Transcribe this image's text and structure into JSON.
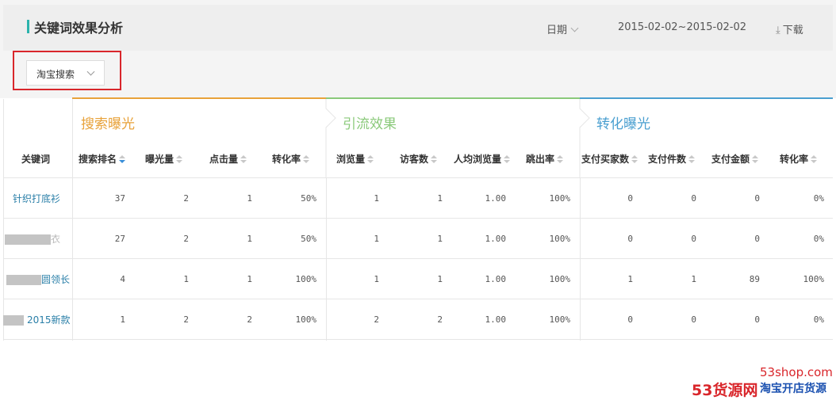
{
  "header": {
    "title": "关键词效果分析",
    "date_label": "日期",
    "date_range": "2015-02-02~2015-02-02",
    "download_label": "下载"
  },
  "filter": {
    "selected": "淘宝搜索"
  },
  "groups": [
    {
      "label": "搜索曝光",
      "color": "#e8a23a"
    },
    {
      "label": "引流效果",
      "color": "#8ac97a"
    },
    {
      "label": "转化曝光",
      "color": "#4a9fd0"
    }
  ],
  "columns": [
    "关键词",
    "搜索排名",
    "曝光量",
    "点击量",
    "转化率",
    "浏览量",
    "访客数",
    "人均浏览量",
    "跳出率",
    "支付买家数",
    "支付件数",
    "支付金额",
    "转化率"
  ],
  "rows": [
    {
      "keyword": "针织打底衫",
      "values": [
        "37",
        "2",
        "1",
        "50%",
        "1",
        "1",
        "1.00",
        "100%",
        "0",
        "0",
        "0",
        "0%"
      ]
    },
    {
      "keyword": "衣",
      "values": [
        "27",
        "2",
        "1",
        "50%",
        "1",
        "1",
        "1.00",
        "100%",
        "0",
        "0",
        "0",
        "0%"
      ]
    },
    {
      "keyword": "圆领长",
      "values": [
        "4",
        "1",
        "1",
        "100%",
        "1",
        "1",
        "1.00",
        "100%",
        "1",
        "1",
        "89",
        "100%"
      ]
    },
    {
      "keyword": "2015新款",
      "values": [
        "1",
        "2",
        "2",
        "100%",
        "2",
        "2",
        "1.00",
        "100%",
        "0",
        "0",
        "0",
        "0%"
      ]
    }
  ],
  "watermark": {
    "site": "53shop.com",
    "brand": "53货源网",
    "slogan": "淘宝开店货源"
  }
}
